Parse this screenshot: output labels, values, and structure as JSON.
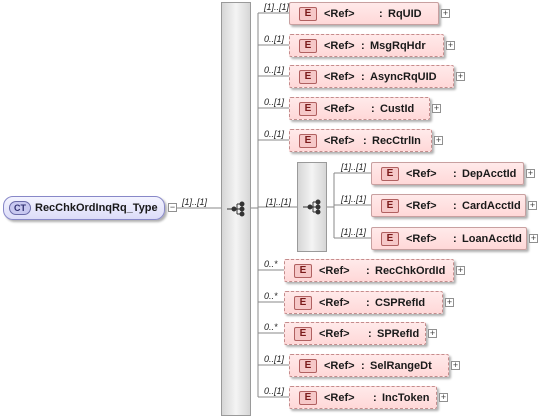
{
  "root": {
    "badge": "CT",
    "name": "RecChkOrdInqRq_Type",
    "cardinality": "[1]..[1]"
  },
  "inner_sequence_cardinality": "[1]..[1]",
  "element_badge": "E",
  "ref_label": "<Ref>",
  "colon": ":",
  "elements": [
    {
      "name": "RqUID",
      "cardinality": "[1]..[1]",
      "optional": false
    },
    {
      "name": "MsgRqHdr",
      "cardinality": "0..[1]",
      "optional": true
    },
    {
      "name": "AsyncRqUID",
      "cardinality": "0..[1]",
      "optional": true
    },
    {
      "name": "CustId",
      "cardinality": "0..[1]",
      "optional": true
    },
    {
      "name": "RecCtrlIn",
      "cardinality": "0..[1]",
      "optional": true
    },
    {
      "name": "RecChkOrdId",
      "cardinality": "0..*",
      "optional": true
    },
    {
      "name": "CSPRefId",
      "cardinality": "0..*",
      "optional": true
    },
    {
      "name": "SPRefId",
      "cardinality": "0..*",
      "optional": true
    },
    {
      "name": "SelRangeDt",
      "cardinality": "0..[1]",
      "optional": true
    },
    {
      "name": "IncToken",
      "cardinality": "0..[1]",
      "optional": true
    }
  ],
  "sub_elements": [
    {
      "name": "DepAcctId",
      "cardinality": "[1]..[1]",
      "optional": false
    },
    {
      "name": "CardAcctId",
      "cardinality": "[1]..[1]",
      "optional": false
    },
    {
      "name": "LoanAcctId",
      "cardinality": "[1]..[1]",
      "optional": false
    }
  ]
}
